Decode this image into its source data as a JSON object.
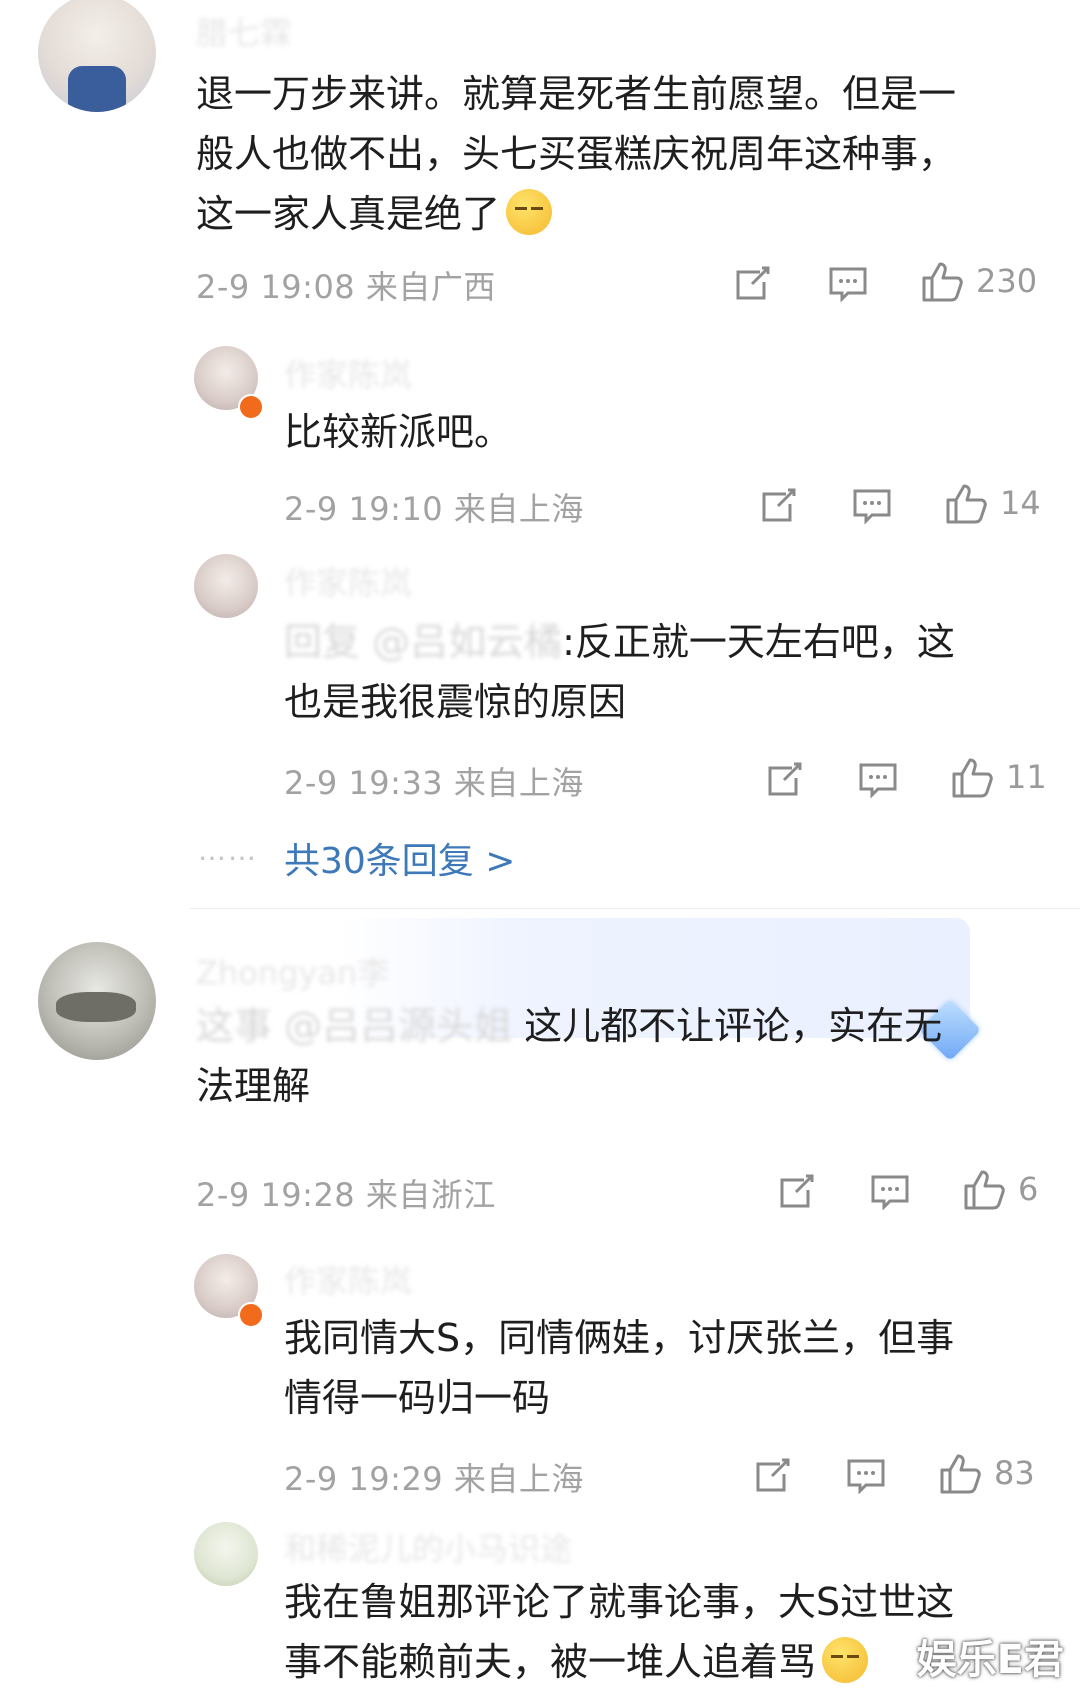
{
  "comments": [
    {
      "name": "腊七霖",
      "text_lines": [
        "退一万步来讲。就算是死者生前愿望。但是一",
        "般人也做不出，头七买蛋糕庆祝周年这种事，",
        "这一家人真是绝了"
      ],
      "meta": "2-9 19:08 来自广西",
      "likes": "230"
    },
    {
      "name": "作家陈岚",
      "text_lines": [
        "比较新派吧。"
      ],
      "meta": "2-9 19:10 来自上海",
      "likes": "14"
    },
    {
      "name": "作家陈岚",
      "reply_prefix": "回复 @吕如云橘",
      "text_lines": [
        ":反正就一天左右吧，这",
        "也是我很震惊的原因"
      ],
      "meta": "2-9 19:33 来自上海",
      "likes": "11"
    },
    {
      "name": "Zhongyan李",
      "mention": "这事 @吕吕源头姐",
      "text_lines": [
        " 这儿都不让评论，实在无",
        "法理解"
      ],
      "meta": "2-9 19:28 来自浙江",
      "likes": "6"
    },
    {
      "name": "作家陈岚",
      "text_lines": [
        "我同情大S，同情俩娃，讨厌张兰，但事",
        "情得一码归一码"
      ],
      "meta": "2-9 19:29 来自上海",
      "likes": "83"
    },
    {
      "name": "和稀泥儿的小马识途",
      "text_lines": [
        "我在鲁姐那评论了就事论事，大S过世这",
        "事不能赖前夫，被一堆人追着骂"
      ],
      "meta": "",
      "likes": ""
    }
  ],
  "more_replies": "共30条回复 >",
  "more_dots": "……",
  "watermark": "娱乐E君",
  "colors": {
    "link": "#3d78b8",
    "meta": "#a2a2a2",
    "badge": "#f26a1b"
  },
  "icons": [
    "share-icon",
    "comment-icon",
    "like-icon",
    "smile-emoji-icon",
    "verified-badge-icon",
    "diamond-badge-icon"
  ]
}
